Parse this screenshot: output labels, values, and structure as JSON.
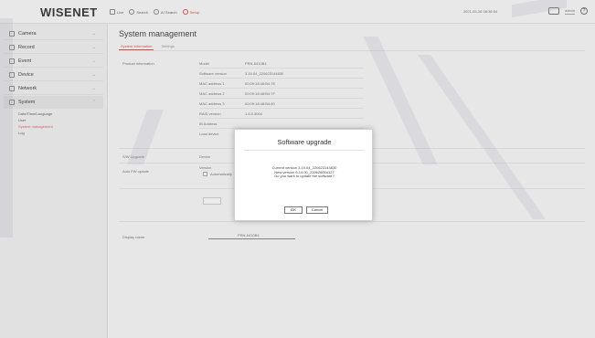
{
  "header": {
    "logo": "WISENET",
    "nav": [
      {
        "label": "Live",
        "icon": "live-icon"
      },
      {
        "label": "Search",
        "icon": "search-icon"
      },
      {
        "label": "AI Search",
        "icon": "ai-search-icon"
      },
      {
        "label": "Setup",
        "icon": "setup-icon",
        "active": true
      }
    ],
    "datetime": "2021-05-26 08:38:54",
    "user": "admin"
  },
  "sidebar": {
    "items": [
      {
        "label": "Camera",
        "icon": "camera-icon"
      },
      {
        "label": "Record",
        "icon": "record-icon"
      },
      {
        "label": "Event",
        "icon": "event-icon"
      },
      {
        "label": "Device",
        "icon": "device-icon"
      },
      {
        "label": "Network",
        "icon": "network-icon"
      },
      {
        "label": "System",
        "icon": "system-icon",
        "active": true
      }
    ],
    "system_sub": [
      "Date/Time/Language",
      "User",
      "System management",
      "Log"
    ]
  },
  "main": {
    "title": "System management",
    "tabs": [
      "System Information",
      "Settings"
    ],
    "section_info": "Product information",
    "info_rows": [
      {
        "label": "Model",
        "value": "PRN-6410B4"
      },
      {
        "label": "Software version",
        "value": "3.19.04_220623144830"
      },
      {
        "label": "MAC address 1",
        "value": "00:09:18:48:B4:7E"
      },
      {
        "label": "MAC address 2",
        "value": "00:09:18:48:B4:7F"
      },
      {
        "label": "MAC address 3",
        "value": "00:09:18:48:B4:80"
      },
      {
        "label": "RAID version",
        "value": "1.6.5.3004"
      },
      {
        "label": "IB Address",
        "value": ""
      },
      {
        "label": "Load device",
        "value": ""
      }
    ],
    "section_upgrade": "S/W Upgrade",
    "upgrade_device": "Device",
    "section_auto": "Auto FW update",
    "auto_label": "Version",
    "auto_checkbox": "Automatically",
    "section_display": "Display name",
    "display_value": "PRN-6410B4"
  },
  "dialog": {
    "title": "Software upgrade",
    "lines": [
      "Current version 3.19.04_220623144830",
      "New version 6.14.00_220626054127",
      "Do you want to update the software?"
    ],
    "ok": "OK",
    "cancel": "Cancel"
  }
}
